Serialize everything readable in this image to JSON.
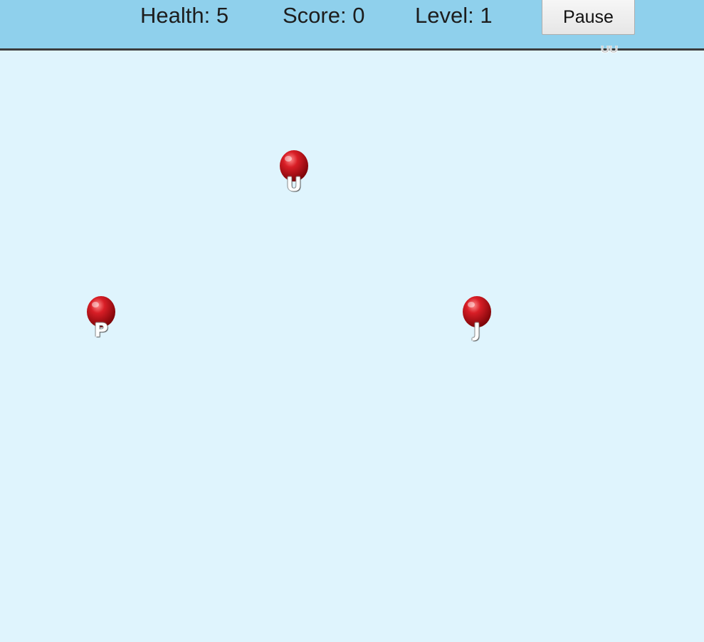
{
  "hud": {
    "health_text": "Health: 5",
    "score_text": "Score: 0",
    "level_text": "Level: 1",
    "pause_label": "Pause"
  },
  "balloons": [
    {
      "letter": "U",
      "color": "#c8141c"
    },
    {
      "letter": "P",
      "color": "#c8141c"
    },
    {
      "letter": "J",
      "color": "#c8141c"
    }
  ],
  "colors": {
    "sky": "#dff4fd",
    "hud_bar": "#8fd0ec",
    "balloon": "#c8141c"
  }
}
